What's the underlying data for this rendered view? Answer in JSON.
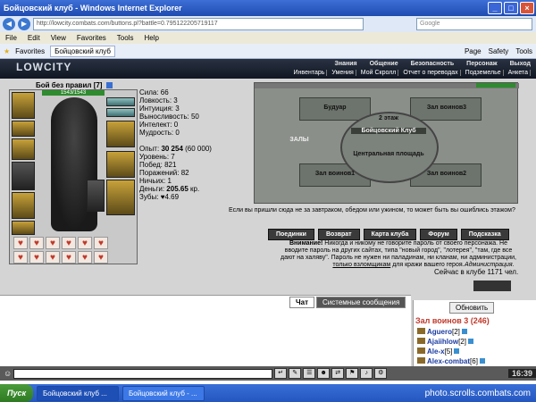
{
  "window": {
    "title": "Бойцовский клуб - Windows Internet Explorer",
    "address": "http://lowcity.combats.com/buttons.pl?battle=0.795122205719117",
    "search_placeholder": "Google",
    "menu": [
      "File",
      "Edit",
      "View",
      "Favorites",
      "Tools",
      "Help"
    ],
    "favorites_label": "Favorites",
    "tab_title": "Бойцовский клуб",
    "toolbar_right": [
      "Page",
      "Safety",
      "Tools"
    ]
  },
  "game": {
    "logo": "LOWCITY",
    "topnav": [
      "Знания",
      "Общение",
      "Безопасность",
      "Персонаж",
      "Выход"
    ],
    "subnav": [
      "Инвентарь",
      "Умения",
      "Мой Скролл",
      "Отчет о переводах",
      "Подземелье",
      "Анкета"
    ],
    "character": {
      "name": "Бой без правил",
      "level": "[7]",
      "hp": "1543/1543"
    },
    "stats": {
      "sila": "Сила: 66",
      "lovkost": "Ловкость: 3",
      "intuicia": "Интуиция: 3",
      "vynoslivost": "Выносливость: 50",
      "intellekt": "Интелект: 0",
      "mudrost": "Мудрость: 0",
      "opyt_label": "Опыт:",
      "opyt_value": "30 254",
      "opyt_next": "(60 000)",
      "uroven": "Уровень: 7",
      "pobed": "Побед: 821",
      "porazheniy": "Поражений: 82",
      "nichyih": "Ничьих: 1",
      "dengi_label": "Деньги:",
      "dengi_value": "205.65",
      "dengi_unit": "кр.",
      "zuby": "Зубы: ♥4.69"
    },
    "map": {
      "labels": [
        "Будуар",
        "Зал воинов3",
        "2 этаж",
        "Бойцовский Клуб",
        "ЗАЛЫ",
        "Центральная площадь",
        "Зал воинов1",
        "Зал воинов2"
      ]
    },
    "caption": "Если вы пришли сюда не за завтраком, обедом или ужином, то может быть вы ошиблись этажом?",
    "buttons": [
      "Поединки",
      "Возврат",
      "Карта клуба",
      "Форум",
      "Подсказка"
    ],
    "warning": {
      "bold": "Внимание!",
      "text": "Никогда и никому не говорите пароль от своего персонажа. Не вводите пароль на других сайтах, типа \"новый город\", \"лотерея\", \"там, где все дают на халяву\". Пароль не нужен ни паладинам, ни кланам, ни администрации,",
      "underline": "только взломщикам",
      "tail": "для кражи вашего героя."
    },
    "admin": "Администрация.",
    "online": "Сейчас в клубе 1171 чел.",
    "chat_tabs": [
      "Чат",
      "Системные сообщения"
    ],
    "refresh": "Обновить",
    "room": "Зал воинов 3 (246)",
    "players": [
      {
        "name": "Aguero",
        "level": "[2]"
      },
      {
        "name": "Ajaiihlow",
        "level": "[2]"
      },
      {
        "name": "Ale-x",
        "level": "[5]"
      },
      {
        "name": "Alex-combat",
        "level": "[6]"
      }
    ],
    "clock": "16:39"
  },
  "taskbar": {
    "start": "Пуск",
    "items": [
      "Бойцовский клуб ...",
      "Бойцовский клуб - ..."
    ],
    "watermark": "photo.scrolls.combats.com"
  },
  "colors": {
    "accent": "#2456bf",
    "room_title": "#c0392b",
    "hp": "#2e8b2e"
  }
}
